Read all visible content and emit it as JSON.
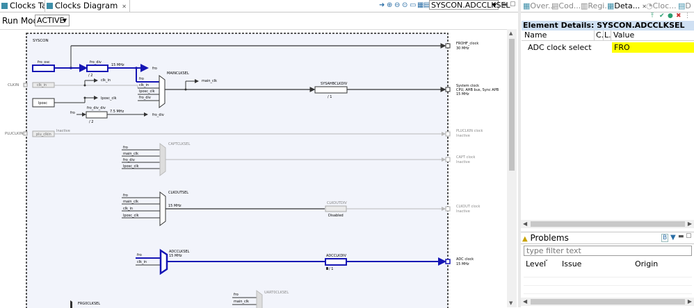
{
  "tabs": {
    "clocks_table": "Clocks Table",
    "clocks_diagram": "Clocks Diagram"
  },
  "toolbar": {
    "peripheral_select": "SYSCON.ADCCLKSEL"
  },
  "run_mode": {
    "label": "Run Mode",
    "value": "ACTIVE"
  },
  "diagram": {
    "syscon": "SYSCON",
    "clkin": "CLKIN",
    "pluclkin": "PLUCLKIN",
    "fro_osc": "fro_osc",
    "fro_div": "fro_div",
    "div2_a": "/ 2",
    "mhz15_a": "15 MHz",
    "fro_a": "fro",
    "froh_clock": "FROHF_clock",
    "froh_mhz": "30 MHz",
    "clk_in_box": "clk_in",
    "clk_in_net": "clk_in",
    "lposc_box": "lposc",
    "lposc_clk_net": "lposc_clk",
    "fro_div_div": "fro_div_div",
    "fro_b": "fro",
    "div2_b": "/ 2",
    "mhz75": "7.5 MHz",
    "fro_div_out": "fro_div",
    "mainclksel": "MAINCLKSEL",
    "mainclk_in": [
      "fro",
      "clk_in",
      "lposc_clk",
      "fro_div"
    ],
    "main_clk_net": "main_clk",
    "sysahbclkdiv": "SYSAHBCLKDIV",
    "div1_a": "/ 1",
    "system_clock": "System clock",
    "system_clock_desc": "CPU, AHB bus, Sync APB",
    "system_mhz": "15 MHz",
    "plu_clkin": "plu_clkin",
    "inactive_a": "Inactive",
    "pluclkin_clock": "PLUCLKIN clock",
    "inactive_b": "Inactive",
    "captclksel": "CAPTCLKSEL",
    "capt_in": [
      "fro",
      "main_clk",
      "fro_div",
      "lposc_clk"
    ],
    "capt_clock": "CAPT clock",
    "inactive_c": "Inactive",
    "clkoutsel": "CLKOUTSEL",
    "clkout_in": [
      "fro",
      "main_clk",
      "clk_in",
      "lposc_clk"
    ],
    "mhz15_c": "15 MHz",
    "clkoutdiv": "CLKOUTDIV",
    "disabled": "Disabled",
    "clkout_clock": "CLKOUT clock",
    "inactive_d": "Inactive",
    "adcclksel": "ADCCLKSEL",
    "adc_mhz": "15 MHz",
    "adc_in": [
      "fro",
      "clk_in"
    ],
    "adcclkdiv": "ADCCLKDIV",
    "div1_b": "/ 1",
    "adc_clock": "ADC clock",
    "adc_clock_mhz": "15 MHz",
    "uart_in": [
      "fro",
      "main_clk"
    ],
    "uart0clksel": "UART0CLKSEL",
    "frgsel": "FRG0CLKSEL"
  },
  "right_tabs": [
    "Over...",
    "Cod...",
    "Regi...",
    "Deta...",
    "Cloc...",
    "D"
  ],
  "element_details": {
    "title": "Element Details: SYSCON.ADCCLKSEL",
    "col_name": "Name",
    "col_c": "C.",
    "col_l": "L.",
    "col_value": "Value",
    "row_label": "ADC clock select",
    "row_value": "FRO"
  },
  "problems": {
    "title": "Problems",
    "filter_placeholder": "type filter text",
    "col_level": "Level",
    "col_issue": "Issue",
    "col_origin": "Origin"
  },
  "colors": {
    "active_path": "#1515b4",
    "inactive_path": "#b8b8b8",
    "highlight": "#ffff00"
  }
}
